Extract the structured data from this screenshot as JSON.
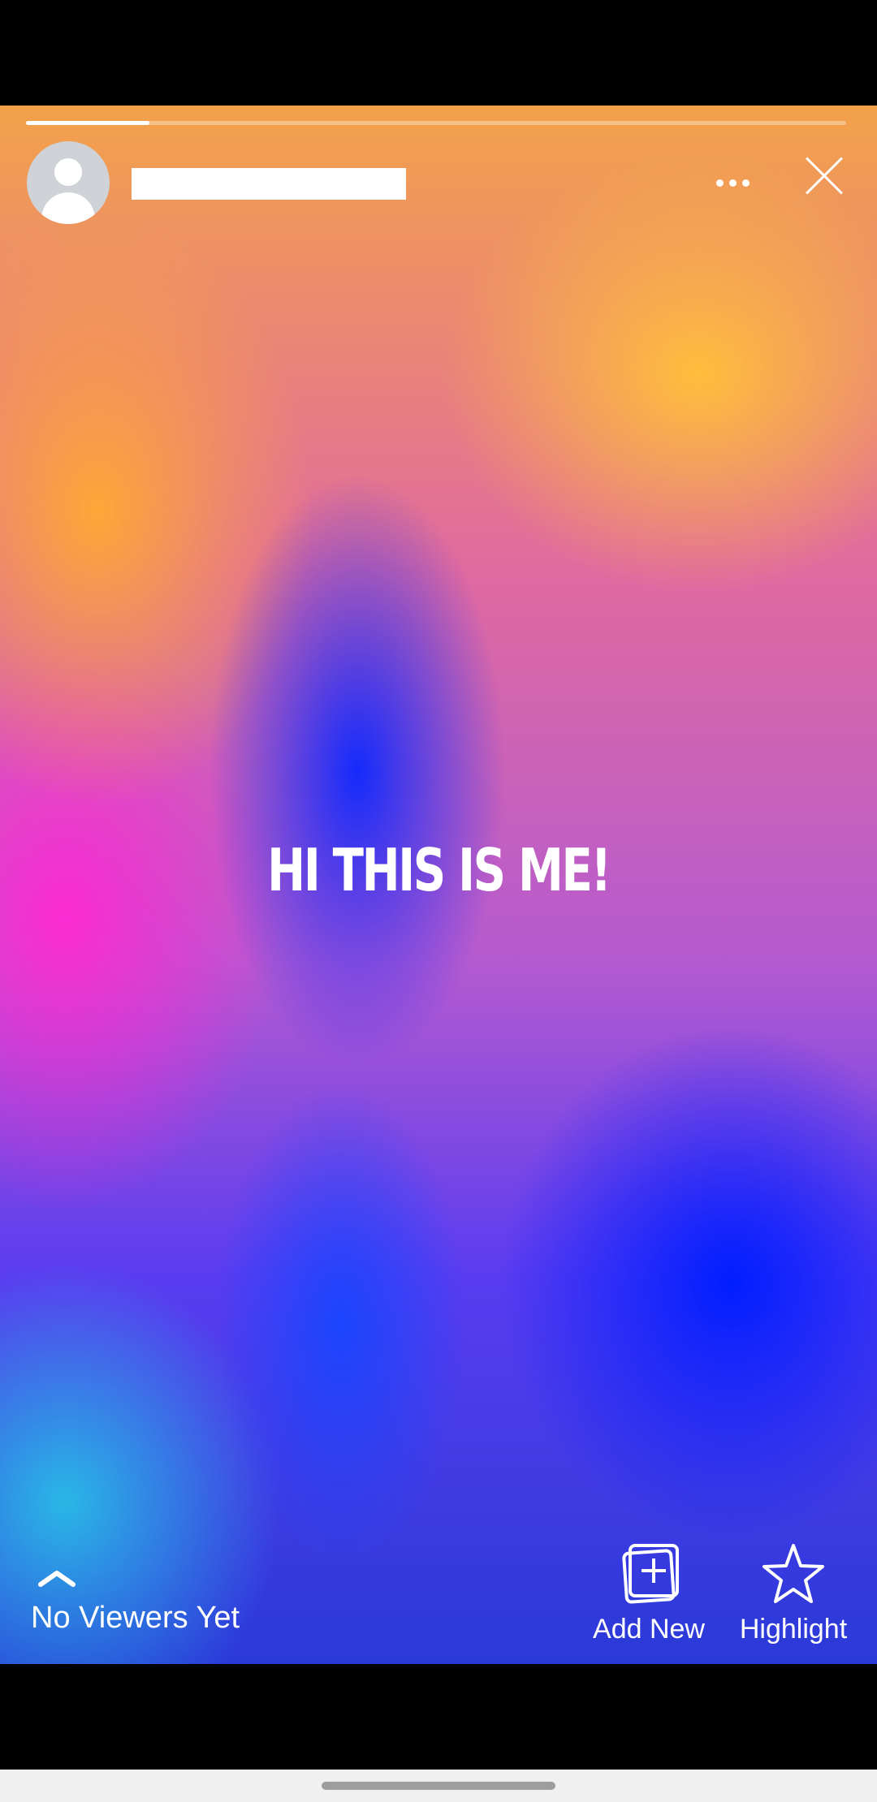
{
  "header": {
    "username": "",
    "icons": {
      "more": "more-horizontal-icon",
      "close": "close-icon"
    }
  },
  "story": {
    "progress_fraction": 0.15,
    "caption": "HI THIS IS ME!"
  },
  "footer": {
    "viewers_label": "No Viewers Yet",
    "add_new_label": "Add New",
    "highlight_label": "Highlight"
  },
  "colors": {
    "text": "#ffffff",
    "progress_track": "rgba(255,255,255,0.35)"
  }
}
